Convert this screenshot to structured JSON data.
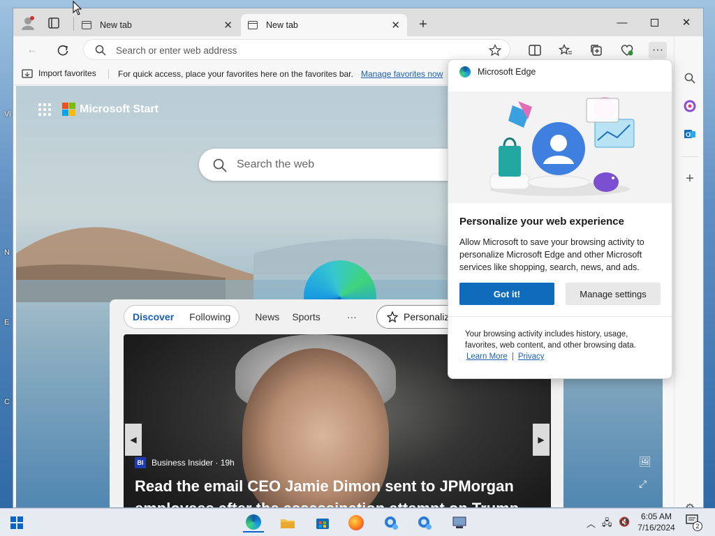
{
  "desktop": {
    "letters": [
      "Vi",
      "N",
      "E",
      "C"
    ]
  },
  "browser": {
    "tabs": [
      {
        "title": "New tab",
        "active": false
      },
      {
        "title": "New tab",
        "active": true
      }
    ],
    "address": {
      "placeholder": "Search or enter web address",
      "value": ""
    },
    "favorites_bar": {
      "import_label": "Import favorites",
      "hint": "For quick access, place your favorites here on the favorites bar.",
      "manage_link": "Manage favorites now"
    }
  },
  "page": {
    "brand": "Microsoft Start",
    "search_placeholder": "Search the web",
    "feed_tabs": [
      "Discover",
      "Following"
    ],
    "feed_categories": [
      "News",
      "Sports"
    ],
    "more": "···",
    "personalize": "Personaliz",
    "hero": {
      "source_badge": "BI",
      "source": "Business Insider · 19h",
      "headline": "Read the email CEO Jamie Dimon sent to JPMorgan employees after the assassination attempt on Trump"
    }
  },
  "popup": {
    "app_name": "Microsoft Edge",
    "title": "Personalize your web experience",
    "description": "Allow Microsoft to save your browsing activity to personalize Microsoft Edge and other Microsoft services like shopping, search, news, and ads.",
    "primary_button": "Got it!",
    "secondary_button": "Manage settings",
    "footer": "Your browsing activity includes history, usage, favorites, web content, and other browsing data.",
    "learn_more": "Learn More",
    "separator": "|",
    "privacy": "Privacy"
  },
  "taskbar": {
    "time": "6:05 AM",
    "date": "7/16/2024",
    "notification_count": "2"
  },
  "colors": {
    "accent": "#0f6cbd",
    "link": "#1a5fb4",
    "ms_logo": [
      "#f25022",
      "#7fba00",
      "#00a4ef",
      "#ffb900"
    ]
  }
}
